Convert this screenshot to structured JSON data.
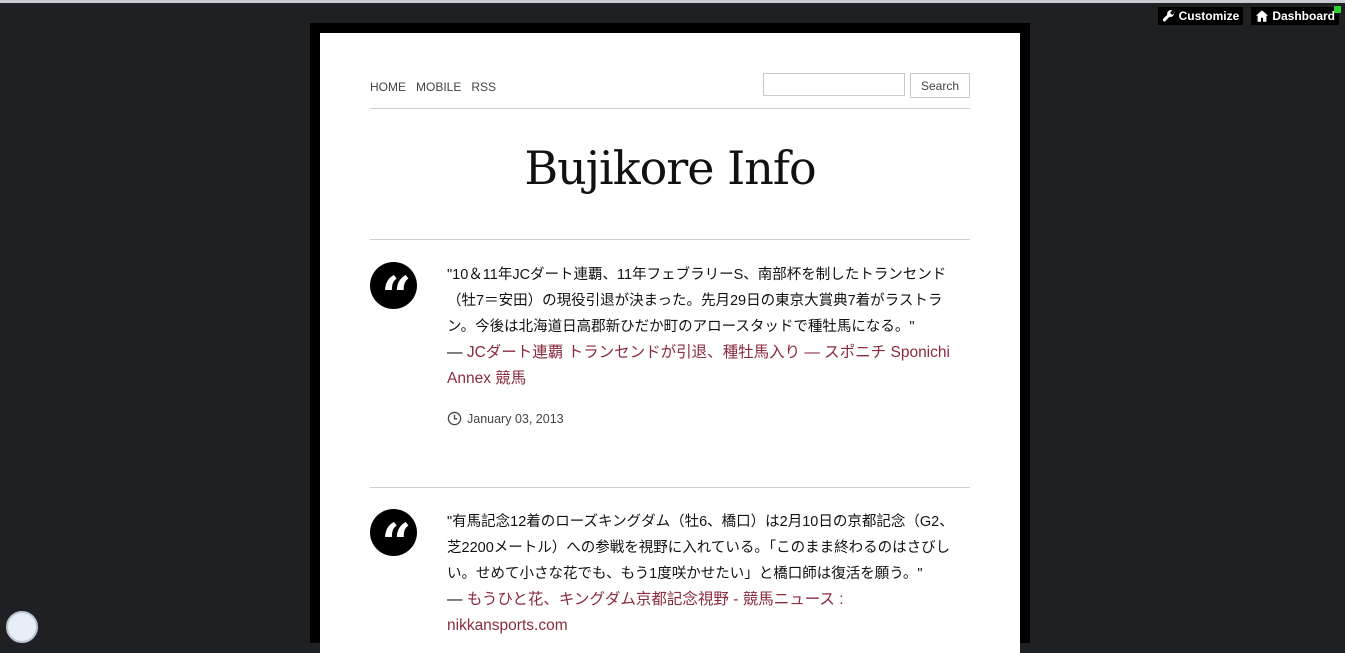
{
  "admin_bar": {
    "customize_label": "Customize",
    "customize_icon": "wrench-icon",
    "dashboard_label": "Dashboard",
    "dashboard_icon": "home-icon"
  },
  "nav": {
    "links": [
      "HOME",
      "MOBILE",
      "RSS"
    ],
    "search_value": "",
    "search_button": "Search"
  },
  "site": {
    "title": "Bujikore Info"
  },
  "posts": [
    {
      "quote": "\"10＆11年JCダート連覇、11年フェブラリーS、南部杯を制したトランセンド（牡7＝安田）の現役引退が決まった。先月29日の東京大賞典7着がラストラン。今後は北海道日高郡新ひだか町のアロースタッドで種牡馬になる。\"",
      "dash": "—",
      "source": "JCダート連覇 トランセンドが引退、種牡馬入り — スポニチ Sponichi Annex 競馬",
      "date": "January 03, 2013",
      "icon": "quote-icon"
    },
    {
      "quote": "\"有馬記念12着のローズキングダム（牡6、橋口）は2月10日の京都記念（G2、芝2200メートル）への参戦を視野に入れている。「このまま終わるのはさびしい。せめて小さな花でも、もう1度咲かせたい」と橋口師は復活を願う。\"",
      "dash": "—",
      "source": "もうひと花、キングダム京都記念視野 - 競馬ニュース : nikkansports.com",
      "icon": "quote-icon"
    }
  ],
  "colors": {
    "background": "#1f2024",
    "link": "#8a2b3e",
    "status_green": "#2bd12b"
  }
}
